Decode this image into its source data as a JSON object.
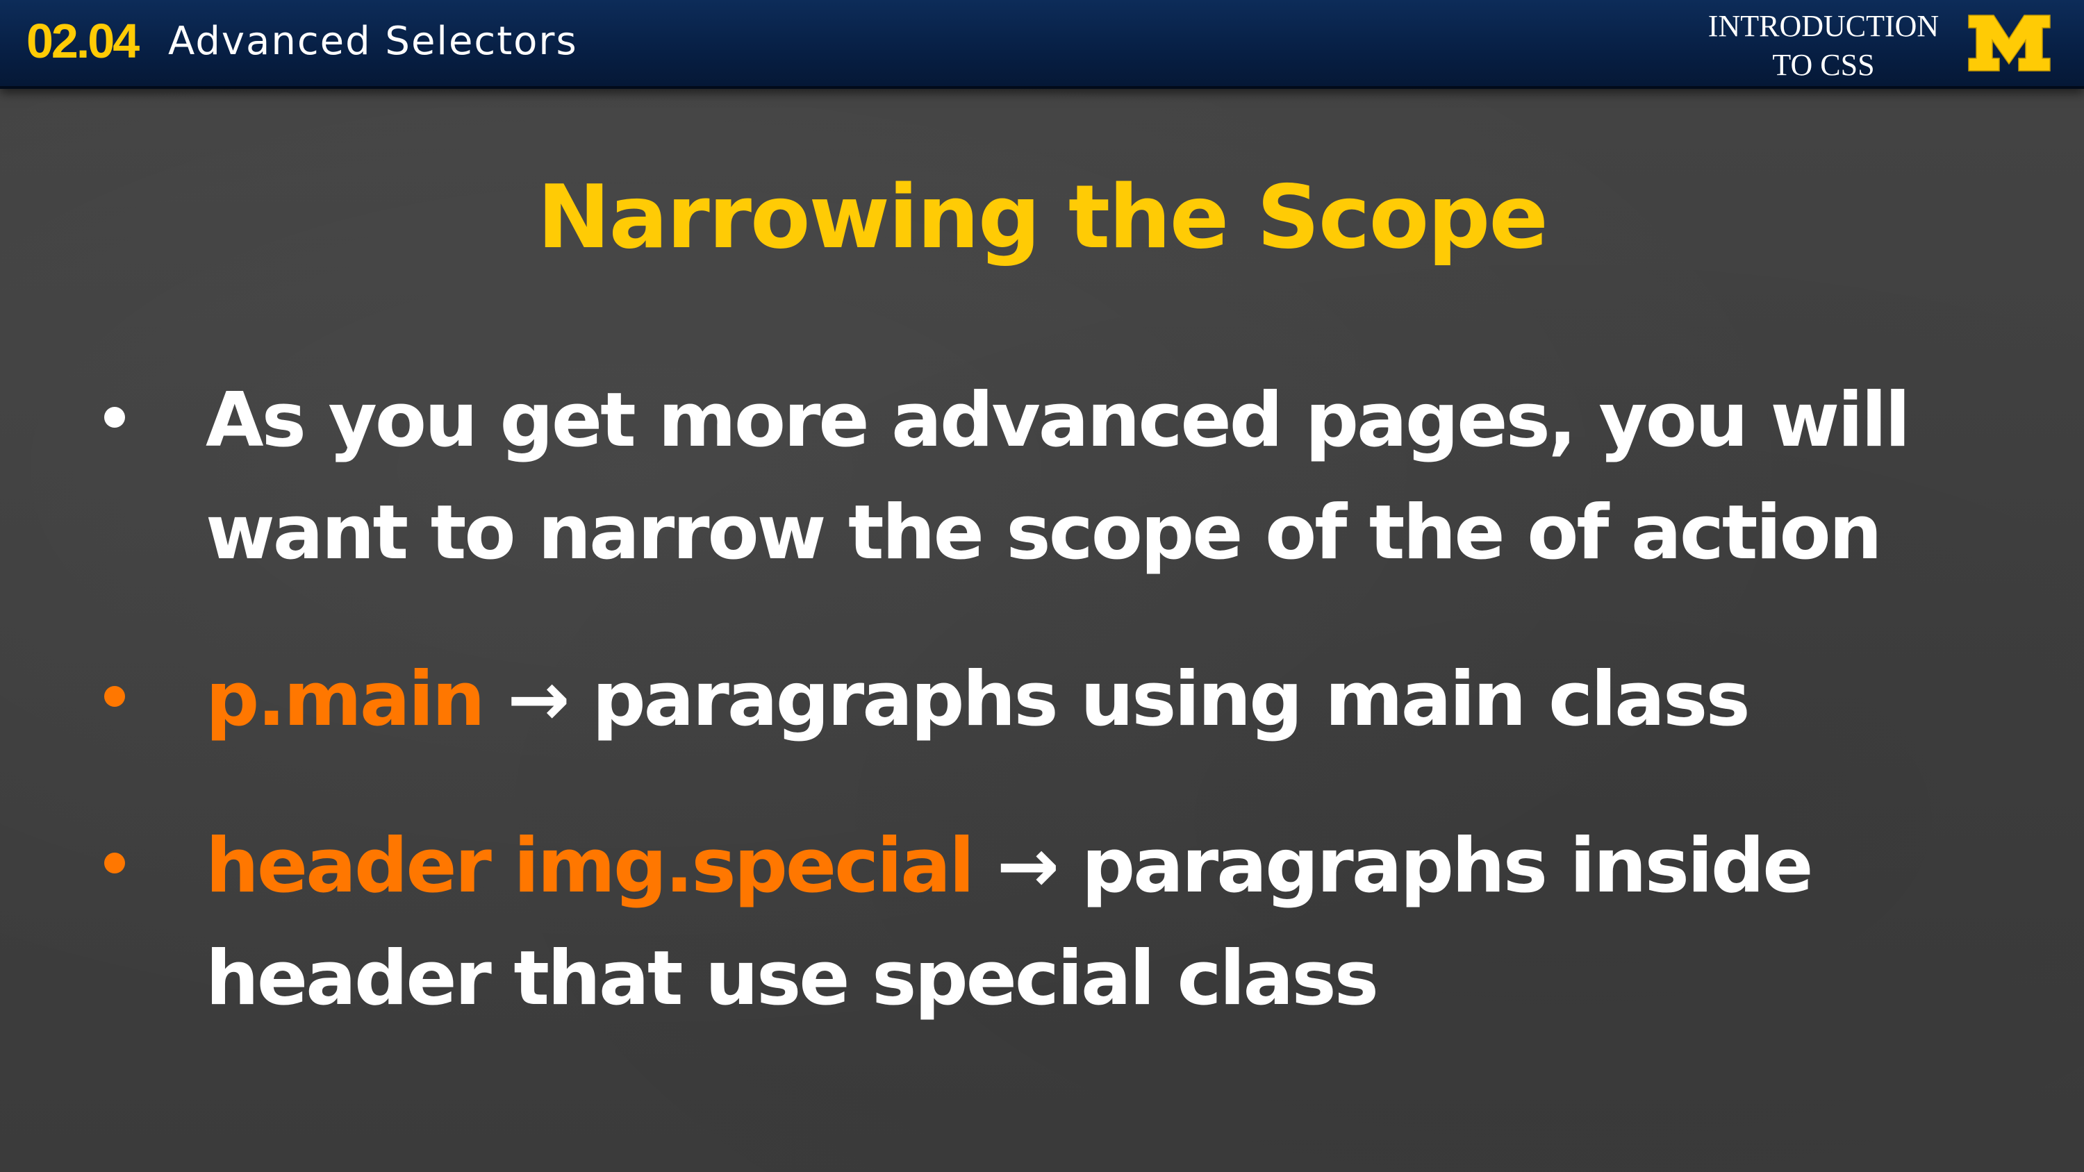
{
  "header": {
    "lesson_number": "02.04",
    "lesson_title": "Advanced Selectors",
    "course_title_line1": "INTRODUCTION",
    "course_title_line2": "TO CSS",
    "logo_icon": "michigan-block-m-icon",
    "logo_letter": "M"
  },
  "slide": {
    "title": "Narrowing the Scope",
    "bullets": [
      {
        "line1": "As you get more advanced pages, you will",
        "line2": "want to narrow the scope of the of action"
      },
      {
        "code": "p.main",
        "arrow": "→",
        "text": "paragraphs using main class"
      },
      {
        "code": "header img.special",
        "arrow": "→",
        "text_line1": "paragraphs inside",
        "text_line2": "header that use special class"
      }
    ]
  },
  "colors": {
    "accent_maize": "#ffcb05",
    "code_orange": "#ff7700",
    "header_blue": "#0a2550",
    "background_gray": "#404040",
    "text_white": "#ffffff"
  }
}
